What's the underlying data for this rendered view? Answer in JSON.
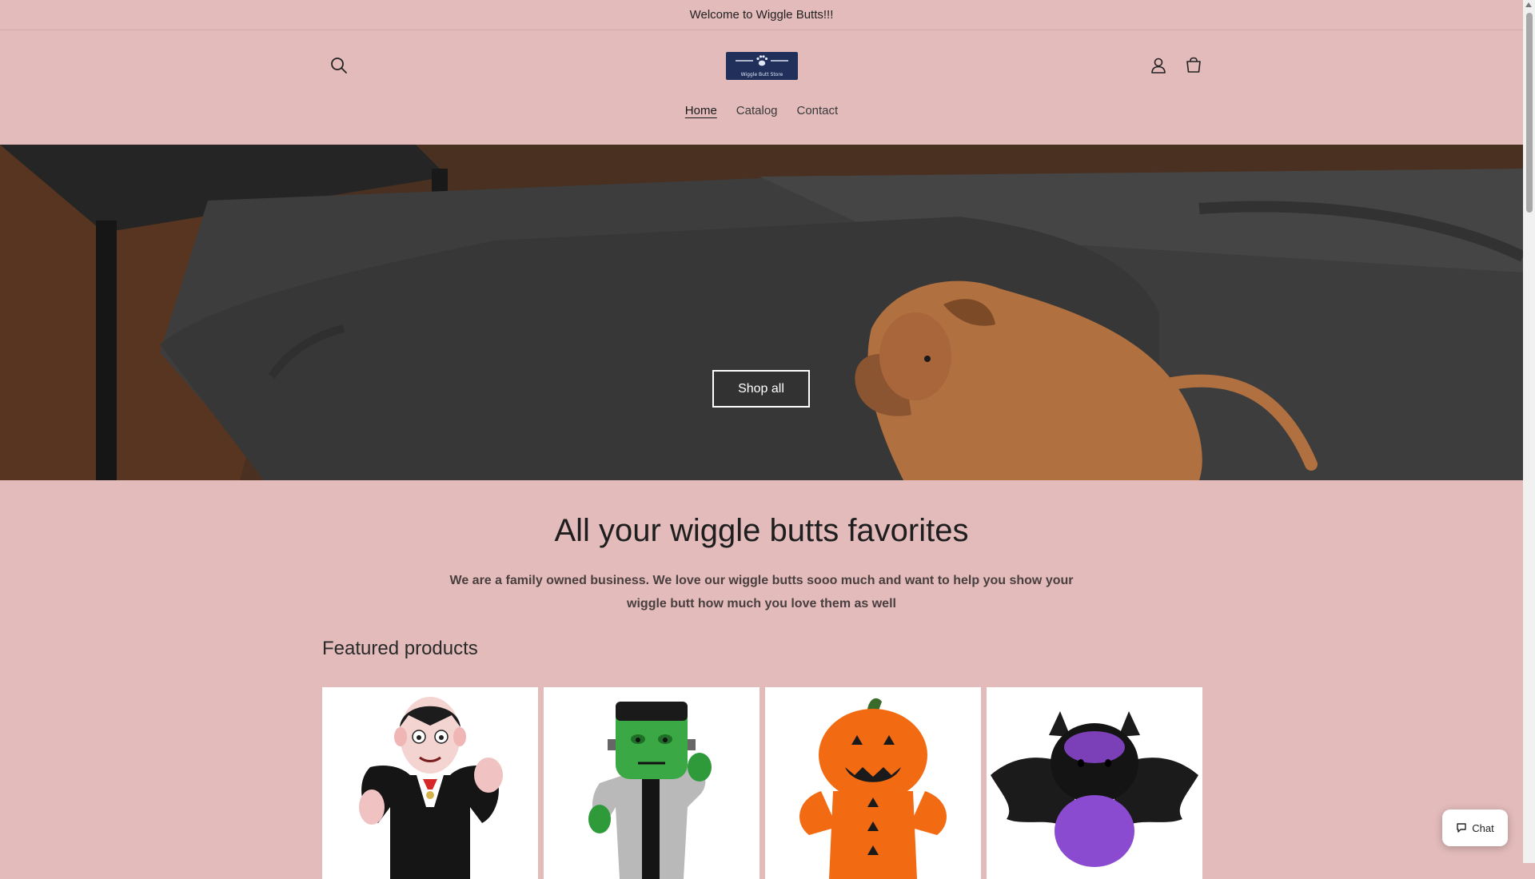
{
  "announcement": {
    "text": "Welcome to Wiggle Butts!!!"
  },
  "header": {
    "logo_text": "Wiggle Butt Store",
    "icons": {
      "search": "search-icon",
      "account": "account-icon",
      "cart": "cart-icon"
    }
  },
  "nav": {
    "items": [
      {
        "label": "Home"
      },
      {
        "label": "Catalog"
      },
      {
        "label": "Contact"
      }
    ]
  },
  "hero": {
    "button_label": "Shop all"
  },
  "intro": {
    "title": "All your wiggle butts favorites",
    "description": "We are a family owned business. We love our wiggle butts sooo much and want to help you show your wiggle butt how much you love them as well"
  },
  "featured": {
    "heading": "Featured products",
    "products": [
      {
        "image": "vampire-plush-toy"
      },
      {
        "image": "frankenstein-plush-toy"
      },
      {
        "image": "pumpkin-plush-toy"
      },
      {
        "image": "bat-plush-toy"
      }
    ]
  },
  "chat": {
    "label": "Chat"
  },
  "colors": {
    "background": "#e3bbbb",
    "logo_background": "#20305a",
    "product_card": "#ffffff"
  }
}
